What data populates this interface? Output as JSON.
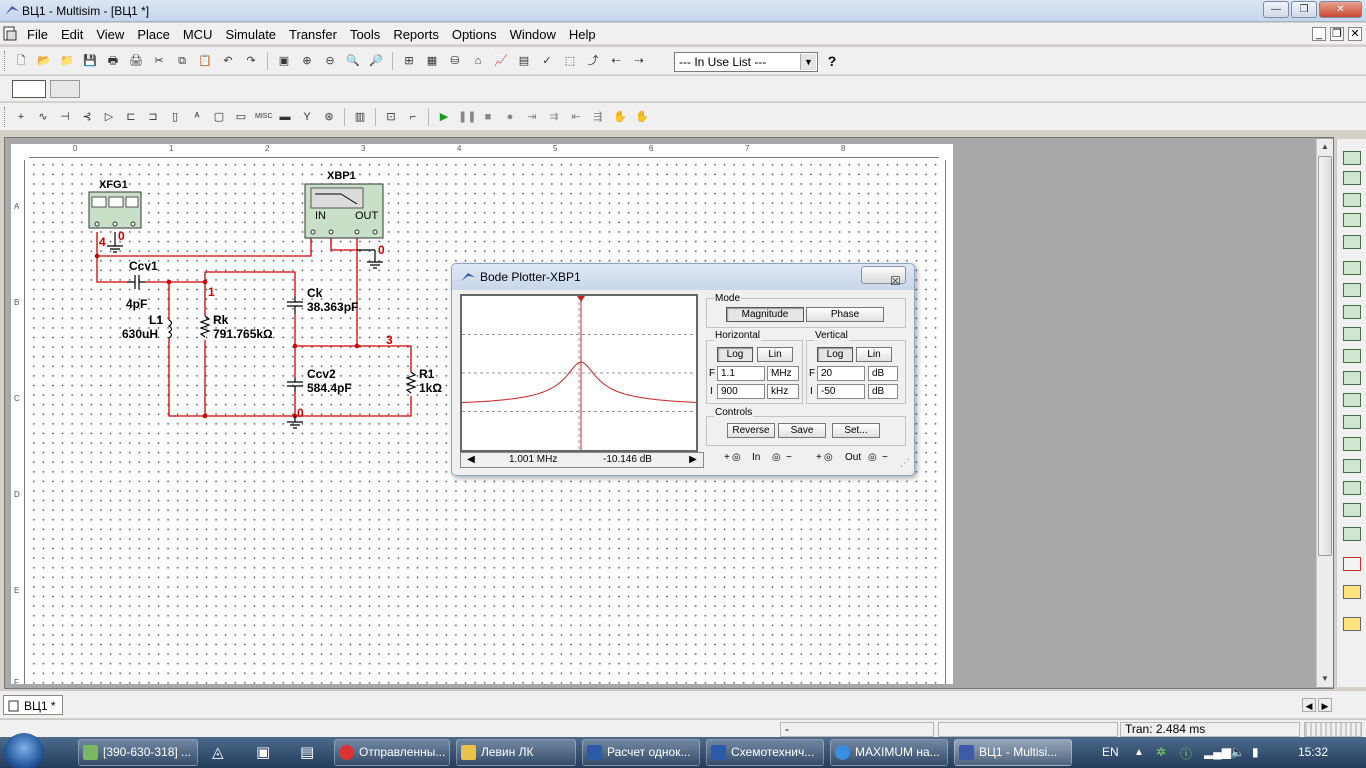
{
  "window": {
    "title": "ВЦ1 - Multisim - [ВЦ1 *]"
  },
  "menu": [
    "File",
    "Edit",
    "View",
    "Place",
    "MCU",
    "Simulate",
    "Transfer",
    "Tools",
    "Reports",
    "Options",
    "Window",
    "Help"
  ],
  "toolbar": {
    "in_use_list": "--- In Use List ---",
    "help": "?"
  },
  "schematic": {
    "ruler_top": [
      "0",
      "1",
      "2",
      "3",
      "4",
      "5",
      "6",
      "7",
      "8"
    ],
    "ruler_left": [
      "A",
      "B",
      "C",
      "D",
      "E",
      "F"
    ],
    "xfg1": "XFG1",
    "xbp1": "XBP1",
    "xbp1_in": "IN",
    "xbp1_out": "OUT",
    "ccv1": "Ccv1",
    "ccv1_val": "4pF",
    "l1": "L1",
    "l1_val": "630uH",
    "rk": "Rk",
    "rk_val": "791.765kΩ",
    "ck": "Ck",
    "ck_val": "38.363pF",
    "ccv2": "Ccv2",
    "ccv2_val": "584.4pF",
    "r1": "R1",
    "r1_val": "1kΩ",
    "node1": "1",
    "node3": "3",
    "node4": "4",
    "node0a": "0",
    "node0b": "0",
    "node0c": "0"
  },
  "bode": {
    "title": "Bode Plotter-XBP1",
    "close": "☒",
    "mode_label": "Mode",
    "magnitude": "Magnitude",
    "phase": "Phase",
    "horizontal_label": "Horizontal",
    "vertical_label": "Vertical",
    "log": "Log",
    "lin": "Lin",
    "h_f_label": "F",
    "h_i_label": "I",
    "h_f_value": "1.1",
    "h_f_unit": "MHz",
    "h_i_value": "900",
    "h_i_unit": "kHz",
    "v_f_label": "F",
    "v_i_label": "I",
    "v_f_value": "20",
    "v_f_unit": "dB",
    "v_i_value": "-50",
    "v_i_unit": "dB",
    "controls_label": "Controls",
    "reverse": "Reverse",
    "save": "Save",
    "set": "Set...",
    "readout_freq": "1.001 MHz",
    "readout_db": "-10.146 dB",
    "in_label": "In",
    "out_label": "Out",
    "plus": "+",
    "minus": "−"
  },
  "tabs": {
    "sheet": "ВЦ1 *"
  },
  "status": {
    "left": "-",
    "right": "Tran: 2.484 ms"
  },
  "taskbar": {
    "tasks": [
      "[390-630-318] ...",
      "Отправленны...",
      "Левин ЛК",
      "Расчет однок...",
      "Схемотехнич...",
      "MAXIMUM на...",
      "ВЦ1 - Multisi..."
    ],
    "lang": "EN",
    "clock": "15:32"
  },
  "colors": {
    "wire": "#d00000",
    "instrument": "#c8e0c8",
    "plot_curve": "#cc2020"
  }
}
